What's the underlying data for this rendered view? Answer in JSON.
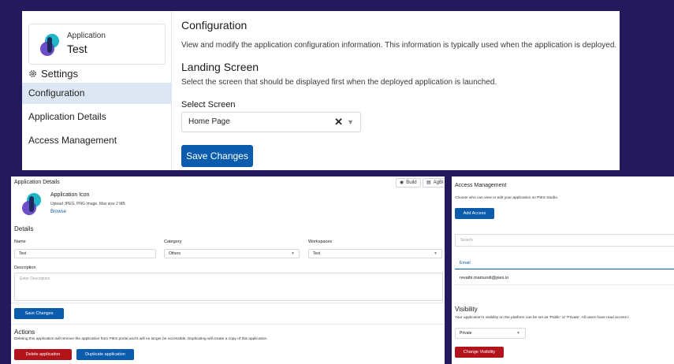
{
  "config": {
    "app_caption": "Application",
    "app_name": "Test",
    "settings_title": "Settings",
    "nav": [
      {
        "label": "Configuration"
      },
      {
        "label": "Application Details"
      },
      {
        "label": "Access Management"
      }
    ],
    "heading": "Configuration",
    "intro": "View and modify the application configuration information. This information is typically used when the application is deployed.",
    "landing_heading": "Landing Screen",
    "landing_desc": "Select the screen that should be displayed first when the deployed application is launched.",
    "select_label": "Select Screen",
    "select_value": "Home Page",
    "save_label": "Save Changes"
  },
  "details": {
    "title": "Application Details",
    "build_label": "Build",
    "agbi_label": "AgBI",
    "icon_title": "Application Icon",
    "icon_hint": "Upload JPEG, PNG Image. Max size 2 MB",
    "browse_label": "Browse",
    "section_details": "Details",
    "name_label": "Name",
    "name_value": "Test",
    "category_label": "Category",
    "category_value": "Others",
    "workspaces_label": "Workspaces",
    "workspaces_value": "Test",
    "description_label": "Description",
    "description_placeholder": "Enter Description",
    "save_label": "Save Changes",
    "actions_title": "Actions",
    "actions_note": "Deleting this application will remove the application from PiES portal and it will no longer be accessible. Duplicating will create a copy of this application.",
    "delete_label": "Delete application",
    "duplicate_label": "Duplicate application"
  },
  "access": {
    "title": "Access Management",
    "desc": "Choose who can view or edit your application on PiES Studio.",
    "add_label": "Add Access",
    "search_placeholder": "Search",
    "email_header": "Email",
    "rows": [
      "revathi.mamundi@pies.io"
    ],
    "visibility_title": "Visibility",
    "visibility_desc": "Your application's visibility on the platform can be set as 'Public' or 'Private'. All users have read access t",
    "visibility_value": "Private",
    "change_label": "Change Visibility"
  },
  "colors": {
    "background": "#24195a",
    "primary": "#0b5cad",
    "danger": "#b3141c",
    "nav_active": "#dde6f3"
  }
}
